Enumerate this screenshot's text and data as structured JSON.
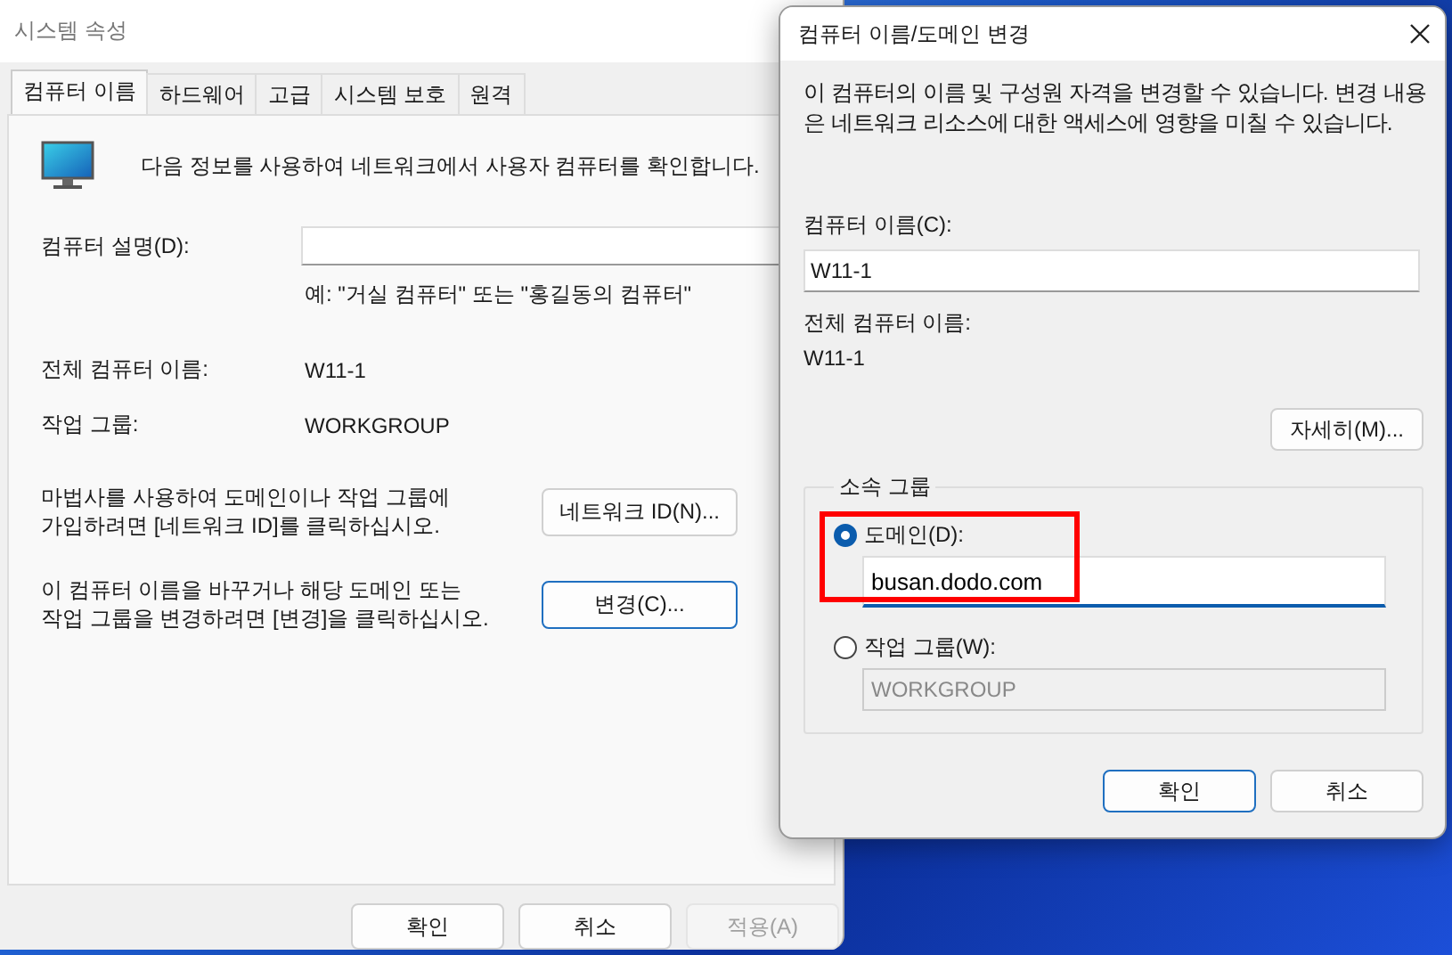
{
  "main_window": {
    "title": "시스템 속성",
    "tabs": [
      {
        "label": "컴퓨터 이름",
        "selected": true
      },
      {
        "label": "하드웨어",
        "selected": false
      },
      {
        "label": "고급",
        "selected": false
      },
      {
        "label": "시스템 보호",
        "selected": false
      },
      {
        "label": "원격",
        "selected": false
      }
    ],
    "intro": "다음 정보를 사용하여 네트워크에서 사용자 컴퓨터를 확인합니다.",
    "description_label": "컴퓨터 설명(D):",
    "description_hint": "예: \"거실 컴퓨터\" 또는 \"홍길동의 컴퓨터\"",
    "full_name_label": "전체 컴퓨터 이름:",
    "full_name": "W11-1",
    "workgroup_label": "작업 그룹:",
    "workgroup": "WORKGROUP",
    "actions": [
      {
        "text": "마법사를 사용하여 도메인이나 작업 그룹에 가입하려면 [네트워크 ID]를 클릭하십시오.",
        "button": "네트워크 ID(N)...",
        "default": false
      },
      {
        "text": "이 컴퓨터 이름을 바꾸거나 해당 도메인 또는 작업 그룹을 변경하려면 [변경]을 클릭하십시오.",
        "button": "변경(C)...",
        "default": true
      }
    ],
    "buttons": [
      {
        "label": "확인",
        "disabled": false
      },
      {
        "label": "취소",
        "disabled": false
      },
      {
        "label": "적용(A)",
        "disabled": true
      }
    ]
  },
  "dialog": {
    "title": "컴퓨터 이름/도메인 변경",
    "intro": "이 컴퓨터의 이름 및 구성원 자격을 변경할 수 있습니다. 변경 내용은 네트워크 리소스에 대한 액세스에 영향을 미칠 수 있습니다.",
    "name_label": "컴퓨터 이름(C):",
    "name_value": "W11-1",
    "full_name_label": "전체 컴퓨터 이름:",
    "full_name": "W11-1",
    "more_button": "자세히(M)...",
    "member_group": {
      "title": "소속 그룹",
      "options": [
        {
          "label": "도메인(D):",
          "selected": true,
          "value": "busan.dodo.com"
        },
        {
          "label": "작업 그룹(W):",
          "selected": false,
          "value": "WORKGROUP"
        }
      ]
    },
    "buttons": [
      {
        "label": "확인",
        "default": true
      },
      {
        "label": "취소",
        "default": false
      }
    ]
  }
}
